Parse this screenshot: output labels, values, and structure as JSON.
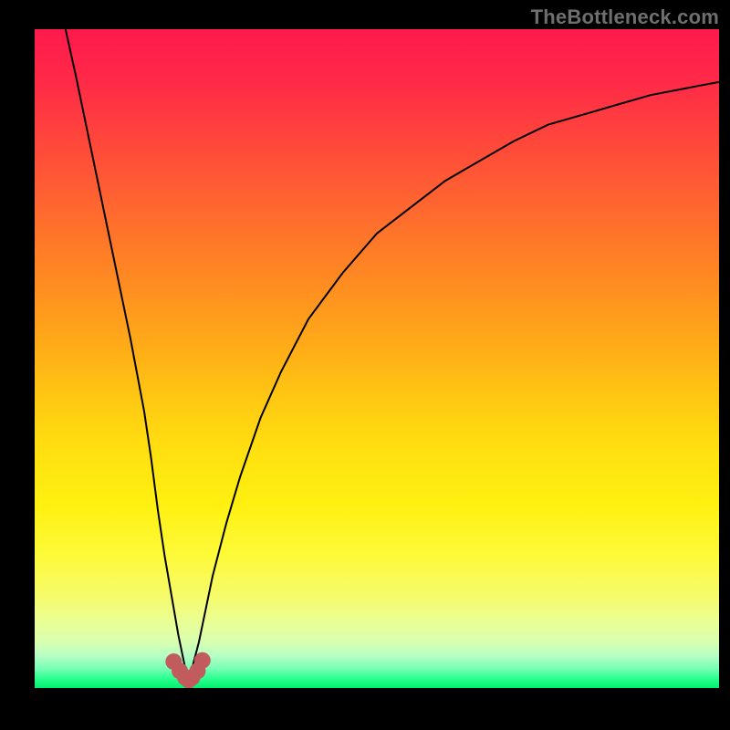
{
  "watermark": "TheBottleneck.com",
  "colors": {
    "background": "#000000",
    "curve": "#000000",
    "markers": "#c15b5d",
    "gradient_top": "#ff1a4d",
    "gradient_bottom": "#00f070",
    "watermark_text": "#6f6f6f"
  },
  "chart_data": {
    "type": "line",
    "title": "",
    "xlabel": "",
    "ylabel": "",
    "xlim": [
      0,
      100
    ],
    "ylim": [
      0,
      100
    ],
    "minimum_location_x": 22.5,
    "series": [
      {
        "name": "curve",
        "x": [
          4.5,
          6,
          8,
          10,
          12,
          14,
          16,
          17,
          18,
          19,
          20,
          21,
          22,
          22.5,
          23,
          24,
          25,
          26,
          28,
          30,
          33,
          36,
          40,
          45,
          50,
          55,
          60,
          65,
          70,
          75,
          80,
          85,
          90,
          95,
          100
        ],
        "values": [
          100,
          93,
          83,
          73,
          63,
          53,
          42,
          35,
          27,
          20,
          14,
          8,
          3,
          1,
          3,
          7,
          12,
          17,
          25,
          32,
          41,
          48,
          56,
          63,
          69,
          73,
          77,
          80,
          83,
          85.5,
          87,
          88.5,
          90,
          91,
          92
        ]
      }
    ],
    "markers": [
      {
        "x": 20.3,
        "y": 4.0
      },
      {
        "x": 21.2,
        "y": 2.6
      },
      {
        "x": 22.0,
        "y": 1.6
      },
      {
        "x": 22.5,
        "y": 1.2
      },
      {
        "x": 23.0,
        "y": 1.6
      },
      {
        "x": 23.8,
        "y": 2.6
      },
      {
        "x": 24.5,
        "y": 4.2
      }
    ]
  }
}
